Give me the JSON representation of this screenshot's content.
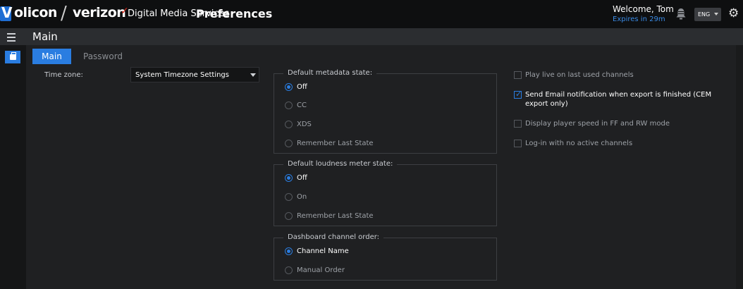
{
  "header": {
    "brand_volicon": "olicon",
    "brand_v": "V",
    "brand_verizon": "verizon",
    "brand_service": "Digital Media Services",
    "title": "Preferences",
    "welcome": "Welcome, Tom",
    "expires": "Expires in 29m",
    "language": "ENG"
  },
  "subheader": {
    "title": "Main"
  },
  "tabs": [
    {
      "label": "Main",
      "active": true
    },
    {
      "label": "Password",
      "active": false
    }
  ],
  "timezone": {
    "label": "Time zone:",
    "value": "System Timezone Settings"
  },
  "metadata": {
    "legend": "Default metadata state:",
    "options": [
      {
        "label": "Off",
        "selected": true
      },
      {
        "label": "CC",
        "selected": false
      },
      {
        "label": "XDS",
        "selected": false
      },
      {
        "label": "Remember Last State",
        "selected": false
      }
    ]
  },
  "loudness": {
    "legend": "Default loudness meter state:",
    "options": [
      {
        "label": "Off",
        "selected": true
      },
      {
        "label": "On",
        "selected": false
      },
      {
        "label": "Remember Last State",
        "selected": false
      }
    ]
  },
  "channel_order": {
    "legend": "Dashboard channel order:",
    "options": [
      {
        "label": "Channel Name",
        "selected": true
      },
      {
        "label": "Manual Order",
        "selected": false
      }
    ]
  },
  "checkboxes": [
    {
      "label": "Play live on last used channels",
      "checked": false
    },
    {
      "label": "Send Email notification when export is finished (CEM export only)",
      "checked": true
    },
    {
      "label": "Display player speed in FF and RW mode",
      "checked": false
    },
    {
      "label": "Log-in with no active channels",
      "checked": false
    }
  ],
  "colors": {
    "accent": "#2a7de1",
    "background": "#1f2022",
    "topbar": "#0e0f10"
  },
  "icons": [
    "menu-icon",
    "briefcase-icon",
    "bell-icon",
    "gear-icon",
    "chevron-down-icon"
  ]
}
